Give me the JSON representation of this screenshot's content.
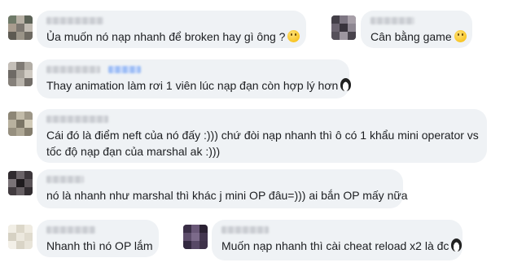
{
  "comments": [
    {
      "text": "Ủa muốn nó nạp nhanh để broken hay gì ông ?",
      "emoji": "smile-emoji"
    },
    {
      "text": "Cân bằng game",
      "emoji": "smile-emoji"
    },
    {
      "text": "Thay animation làm rơi 1 viên lúc nạp đạn còn hợp lý hơn",
      "emoji": "penguin-emoji"
    },
    {
      "line1": "Cái đó là điểm neft của nó đấy :))) chứ đòi nạp nhanh thì ô có 1 khẩu mini operator vs",
      "line2": "tốc độ nạp đạn của marshal ak :)))"
    },
    {
      "text": "nó là nhanh như marshal thì khác j mini OP đâu=))) ai bắn OP mấy nữa"
    },
    {
      "text": "Nhanh thì nó OP lắm"
    },
    {
      "text": "Muốn nạp nhanh thì cài cheat reload x2 là đc",
      "emoji": "penguin-emoji"
    }
  ],
  "colors": {
    "bubble": "#eff2f5",
    "text": "#1c1e21",
    "tag": "#9bbcf5"
  }
}
